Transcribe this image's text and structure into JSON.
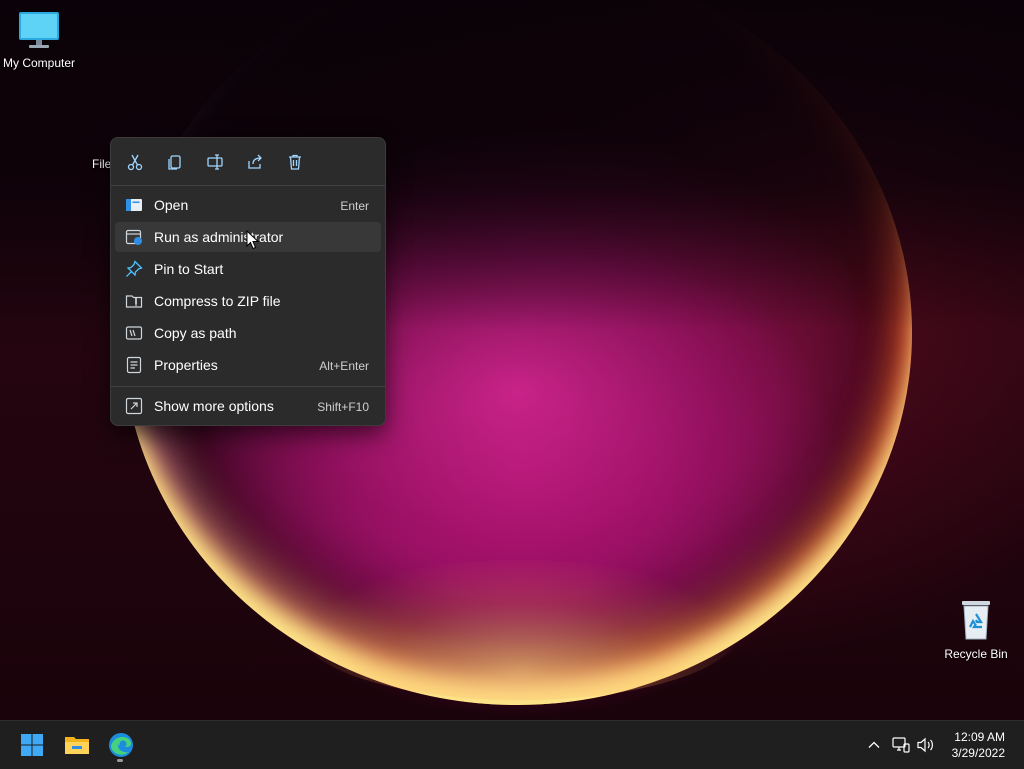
{
  "desktop": {
    "icons": [
      {
        "label": "My Computer",
        "icon": "computer-icon"
      },
      {
        "label": "Recycle Bin",
        "icon": "recycle-bin-icon"
      }
    ],
    "selected_file_label": "File"
  },
  "context_menu": {
    "toolbar": [
      {
        "action": "Cut",
        "icon": "scissors-icon"
      },
      {
        "action": "Copy",
        "icon": "copy-icon"
      },
      {
        "action": "Rename",
        "icon": "rename-icon"
      },
      {
        "action": "Share",
        "icon": "share-icon"
      },
      {
        "action": "Delete",
        "icon": "trash-icon"
      }
    ],
    "items": [
      {
        "label": "Open",
        "shortcut": "Enter",
        "icon": "open-icon"
      },
      {
        "label": "Run as administrator",
        "shortcut": "",
        "icon": "shield-run-icon",
        "hovered": true
      },
      {
        "label": "Pin to Start",
        "shortcut": "",
        "icon": "pin-icon"
      },
      {
        "label": "Compress to ZIP file",
        "shortcut": "",
        "icon": "zip-icon"
      },
      {
        "label": "Copy as path",
        "shortcut": "",
        "icon": "path-icon"
      },
      {
        "label": "Properties",
        "shortcut": "Alt+Enter",
        "icon": "properties-icon"
      }
    ],
    "more": {
      "label": "Show more options",
      "shortcut": "Shift+F10",
      "icon": "more-options-icon"
    }
  },
  "taskbar": {
    "apps": [
      {
        "name": "Start",
        "icon": "windows-start-icon"
      },
      {
        "name": "File Explorer",
        "icon": "folder-icon"
      },
      {
        "name": "Microsoft Edge",
        "icon": "edge-icon",
        "running": true
      }
    ],
    "tray": {
      "icons": [
        "chevron-up-icon",
        "network-icon",
        "volume-icon"
      ],
      "time": "12:09 AM",
      "date": "3/29/2022"
    }
  },
  "colors": {
    "menu_bg": "#2b2b2b",
    "menu_hover": "#383838",
    "accent": "#4cc2ff",
    "taskbar_bg": "#1f1f1f"
  }
}
